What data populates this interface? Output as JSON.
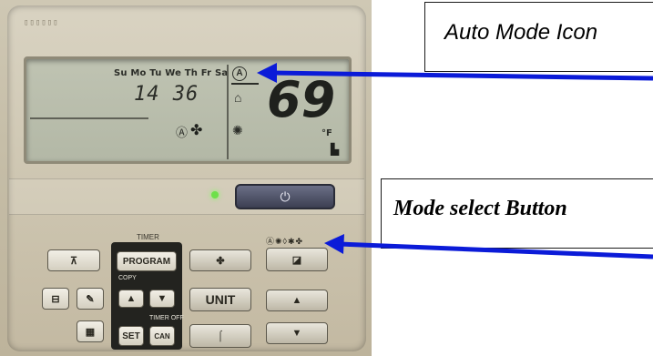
{
  "callouts": {
    "auto_mode": "Auto Mode Icon",
    "mode_select": "Mode select Button"
  },
  "lcd": {
    "days": "Su Mo Tu We Th Fr Sa",
    "clock": "14 36",
    "temperature": "69",
    "unit": "°F"
  },
  "panel": {
    "timer_label": "TIMER",
    "program_button": "PROGRAM",
    "copy_label": "COPY",
    "unit_button": "UNIT",
    "set_button": "SET",
    "can_button": "CAN",
    "timer_off_label": "TIMER OFF"
  },
  "colors": {
    "arrow": "#0b1bd8",
    "lcd": "#b8bcaa",
    "power_button": "#4a4d62",
    "led": "#6ee04a"
  },
  "icons": {
    "auto_mode": "circled-a-icon",
    "fan": "fan-icon",
    "power": "power-icon"
  }
}
